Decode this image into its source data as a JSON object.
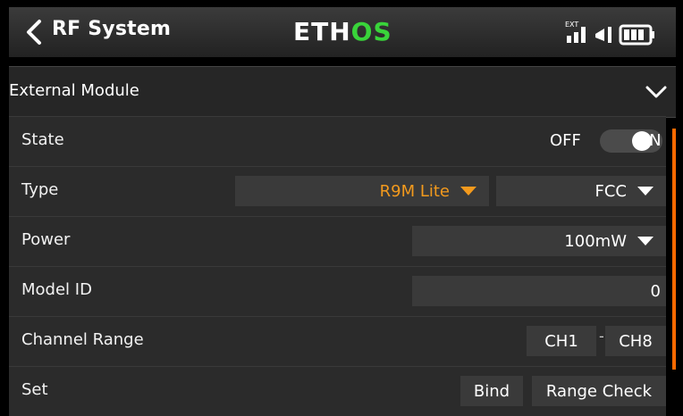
{
  "app": {
    "title": "RF System",
    "logo_left": "ETH",
    "logo_right": "OS",
    "status_exit_label": "EXT"
  },
  "section": {
    "title": "External Module"
  },
  "rows": {
    "state": {
      "label": "State",
      "off": "OFF",
      "on": "ON"
    },
    "type": {
      "label": "Type",
      "value": "R9M Lite",
      "region": "FCC"
    },
    "power": {
      "label": "Power",
      "value": "100mW"
    },
    "model_id": {
      "label": "Model ID",
      "value": "0"
    },
    "channel_range": {
      "label": "Channel Range",
      "from": "CH1",
      "separator": "-",
      "to": "CH8"
    },
    "set": {
      "label": "Set",
      "bind": "Bind",
      "range_check": "Range Check"
    }
  },
  "colors": {
    "accent": "#f39a1d",
    "logo_green": "#39d43a",
    "scroll_orange": "#ff6a00"
  }
}
